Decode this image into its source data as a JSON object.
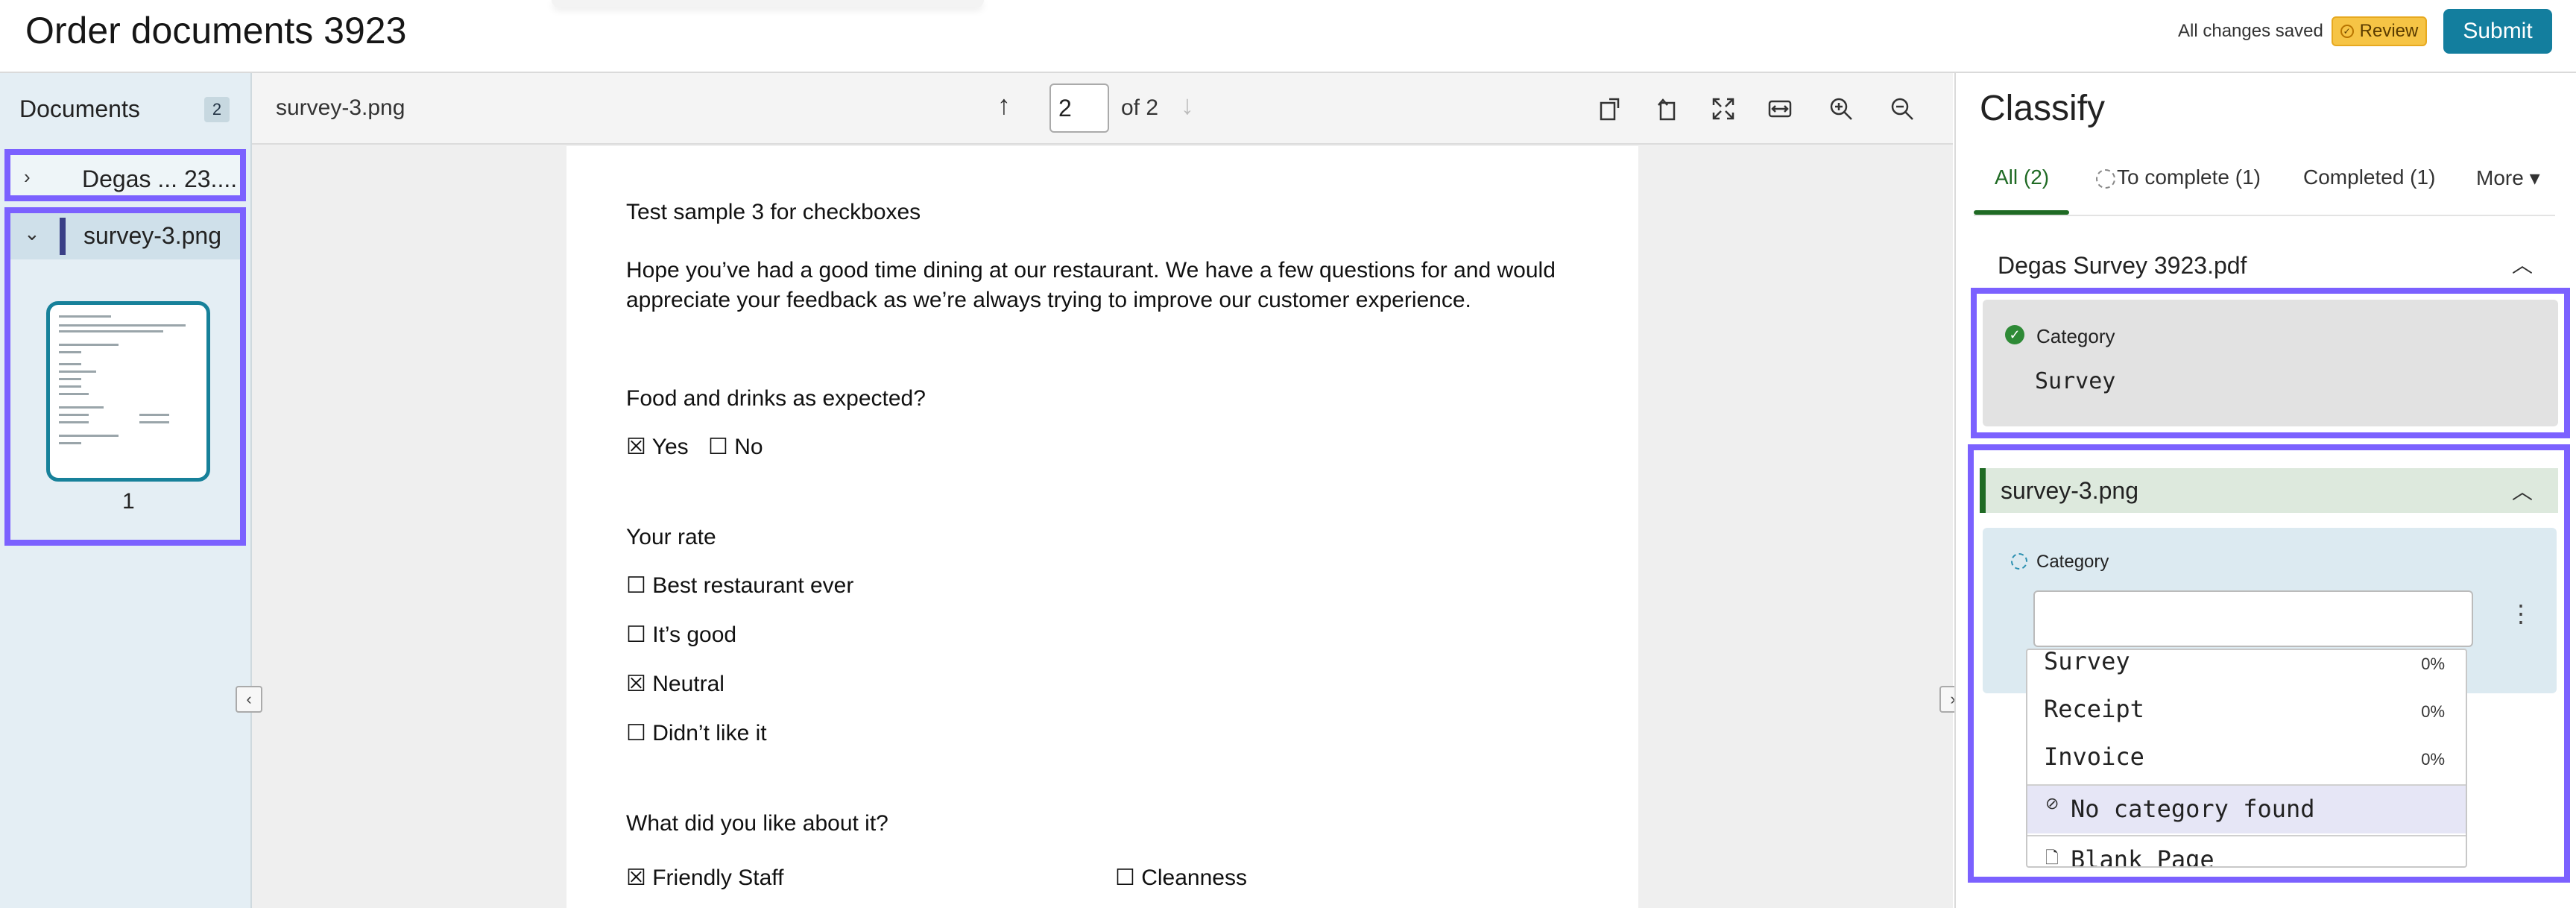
{
  "header": {
    "title": "Order documents 3923",
    "status": "All changes saved",
    "review_label": "Review",
    "submit_label": "Submit"
  },
  "sidebar": {
    "label": "Documents",
    "count": "2",
    "docs": [
      {
        "label": "Degas ... 23...."
      },
      {
        "label": "survey-3.png"
      }
    ],
    "thumbnail_page": "1"
  },
  "viewer": {
    "filename": "survey-3.png",
    "page_input": "2",
    "page_of": "of 2",
    "content": {
      "title": "Test sample 3 for checkboxes",
      "intro_line1": "Hope you’ve had a good time dining at our restaurant. We have a few questions for and would",
      "intro_line2": "appreciate your feedback as we’re always trying to improve our customer experience.",
      "q1": "Food and drinks as expected?",
      "q1_yes": "☒ Yes",
      "q1_no": "☐ No",
      "q2": "Your rate",
      "q2_opt1": "☐ Best restaurant ever",
      "q2_opt2": "☐ It’s good",
      "q2_opt3": "☒ Neutral",
      "q2_opt4": "☐ Didn’t like it",
      "q3": "What did you like about it?",
      "q3_opt1": "☒ Friendly Staff",
      "q3_opt2": "☐ Cleanness"
    }
  },
  "classify": {
    "title": "Classify",
    "tabs": {
      "all": "All (2)",
      "to_complete": "To complete (1)",
      "completed": "Completed (1)",
      "more": "More ▾"
    },
    "section1": {
      "title": "Degas Survey 3923.pdf",
      "field_label": "Category",
      "field_value": "Survey"
    },
    "section2": {
      "title": "survey-3.png",
      "field_label": "Category",
      "input_value": "",
      "options": [
        {
          "label": "Survey",
          "pct": "0%"
        },
        {
          "label": "Receipt",
          "pct": "0%"
        },
        {
          "label": "Invoice",
          "pct": "0%"
        },
        {
          "label": "No category found",
          "pct": ""
        },
        {
          "label": "Blank Page",
          "pct": ""
        }
      ]
    }
  },
  "colors": {
    "accent": "#137e9e",
    "review": "#f6c445",
    "success": "#2e8a36",
    "selection": "#7b61ff"
  }
}
